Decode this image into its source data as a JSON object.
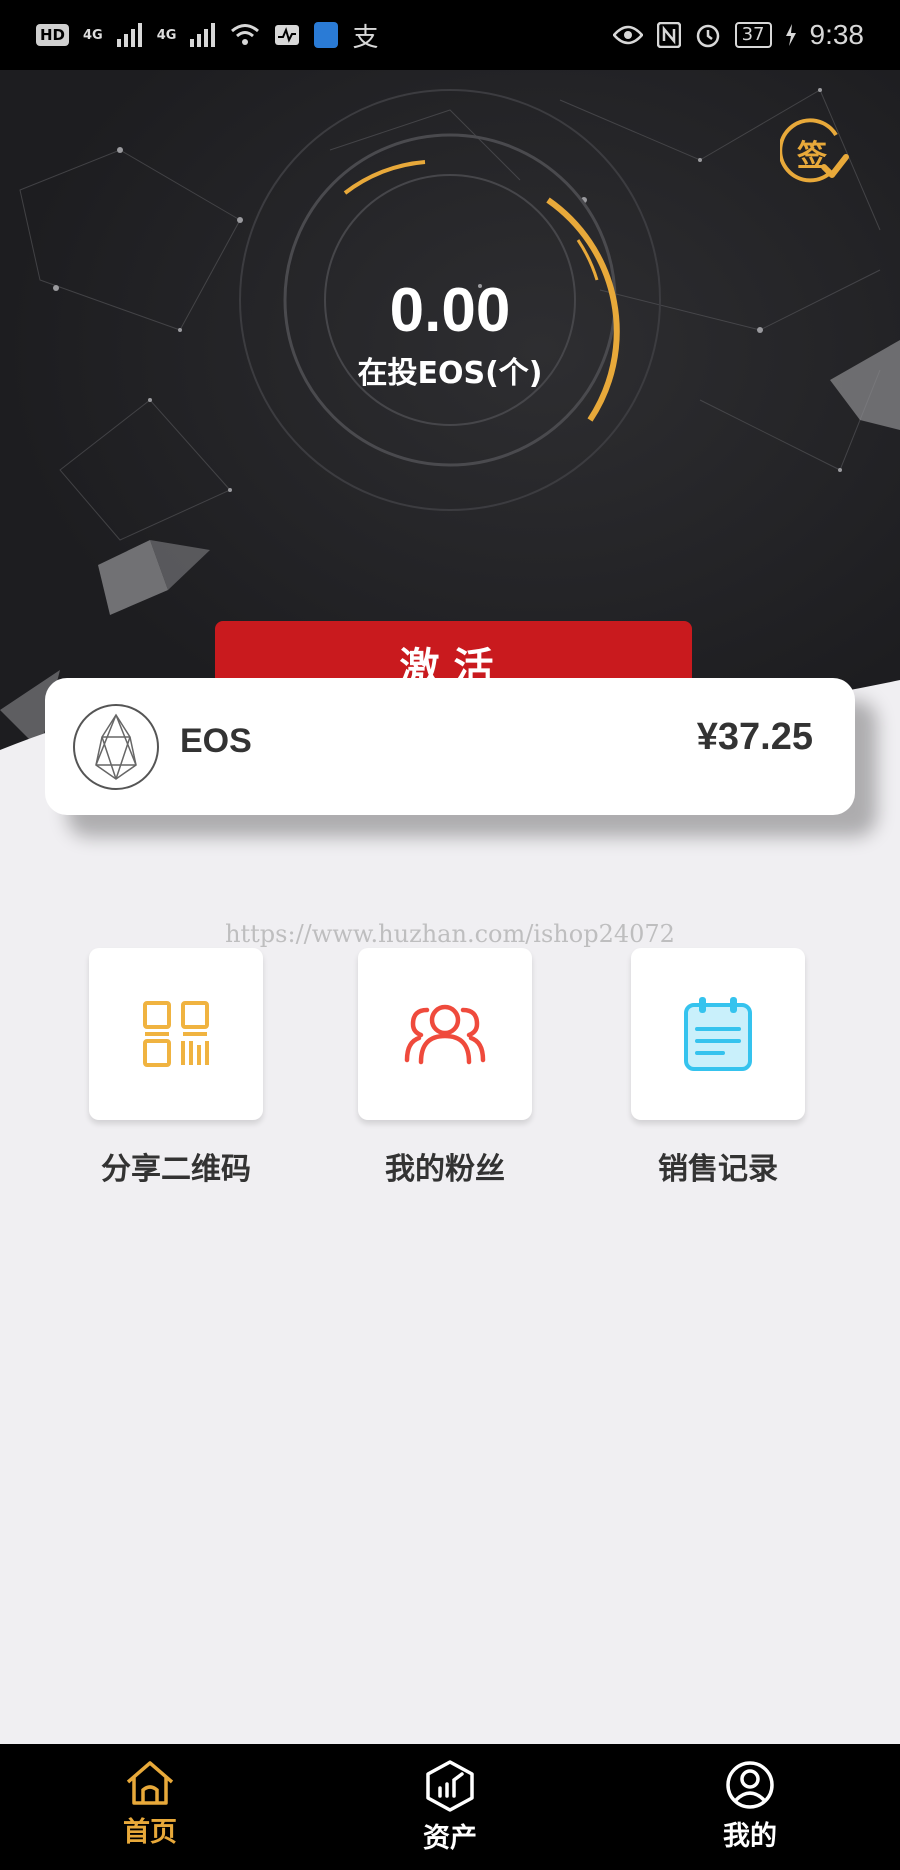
{
  "status_bar": {
    "hd": "HD",
    "net1": "4G",
    "net2": "4G",
    "alipay_glyph": "支",
    "battery": "37",
    "time": "9:38",
    "icons": [
      "signal-icon",
      "wifi-icon",
      "activity-icon",
      "shield-icon",
      "eye-icon",
      "nfc-icon",
      "alarm-icon",
      "charging-icon"
    ]
  },
  "hero": {
    "amount": "0.00",
    "caption": "在投EOS(个)",
    "sign_in_glyph": "签",
    "accent_color": "#e8a93a"
  },
  "activate_button": {
    "label": "激活",
    "color": "#c91a1e"
  },
  "coin_card": {
    "name": "EOS",
    "price": "¥37.25"
  },
  "watermark": "https://www.huzhan.com/ishop24072",
  "features": [
    {
      "label": "分享二维码",
      "icon": "qr-code-icon",
      "color": "#f0b340"
    },
    {
      "label": "我的粉丝",
      "icon": "fans-icon",
      "color": "#ef4a3c"
    },
    {
      "label": "销售记录",
      "icon": "sales-record-icon",
      "color": "#35c3ee"
    }
  ],
  "bottom_nav": [
    {
      "label": "首页",
      "icon": "home-icon",
      "active": true
    },
    {
      "label": "资产",
      "icon": "assets-icon",
      "active": false
    },
    {
      "label": "我的",
      "icon": "profile-icon",
      "active": false
    }
  ]
}
